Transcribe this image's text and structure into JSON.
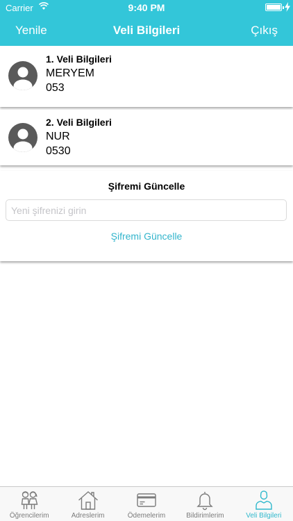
{
  "status_bar": {
    "carrier": "Carrier",
    "time": "9:40 PM"
  },
  "nav": {
    "left_label": "Yenile",
    "title": "Veli Bilgileri",
    "right_label": "Çıkış"
  },
  "parents": [
    {
      "title": "1. Veli Bilgileri",
      "name": "MERYEM",
      "phone": "053"
    },
    {
      "title": "2. Veli Bilgileri",
      "name": "NUR",
      "phone": "0530"
    }
  ],
  "password": {
    "title": "Şifremi Güncelle",
    "placeholder": "Yeni şifrenizi girin",
    "button_label": "Şifremi Güncelle"
  },
  "tabs": [
    {
      "label": "Öğrencilerim",
      "icon": "students-icon"
    },
    {
      "label": "Adreslerim",
      "icon": "house-icon"
    },
    {
      "label": "Ödemelerim",
      "icon": "card-icon"
    },
    {
      "label": "Bildirimlerim",
      "icon": "bell-icon"
    },
    {
      "label": "Veli Bilgileri",
      "icon": "person-icon",
      "active": true
    }
  ],
  "colors": {
    "accent": "#33c6d9",
    "tab_active": "#2fb8cc",
    "tab_inactive": "#7b7b7b",
    "avatar": "#5a5a5a"
  }
}
